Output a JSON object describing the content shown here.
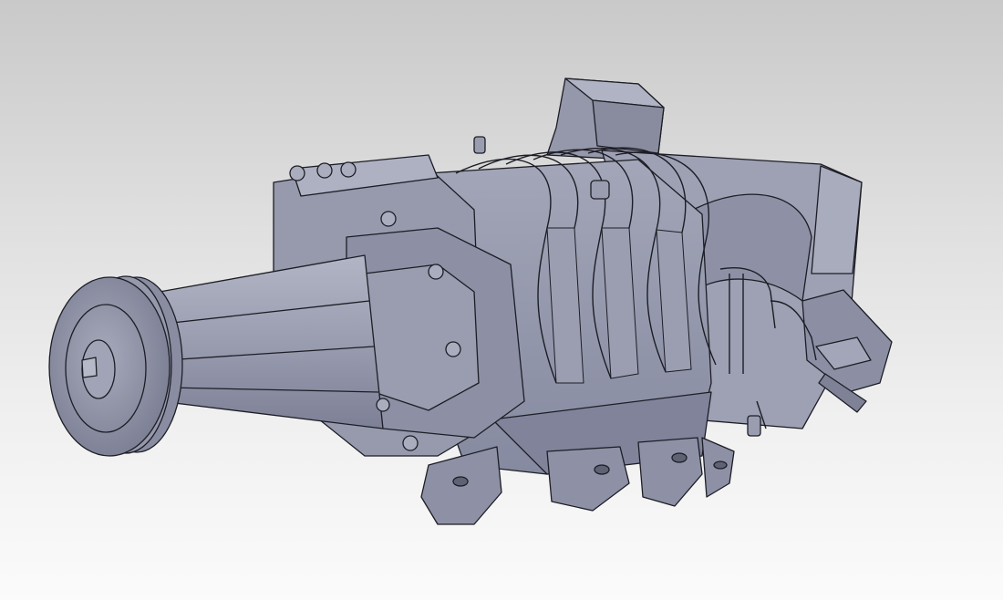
{
  "viewport": {
    "background_top": "#c9c9c9",
    "background_bottom": "#fbfbfb"
  },
  "model": {
    "subject": "supercharger",
    "body_color": "#8f92a6",
    "highlight_color": "#c3c6d6",
    "shadow_color": "#5f6274",
    "edge_color": "#1c1d25"
  }
}
